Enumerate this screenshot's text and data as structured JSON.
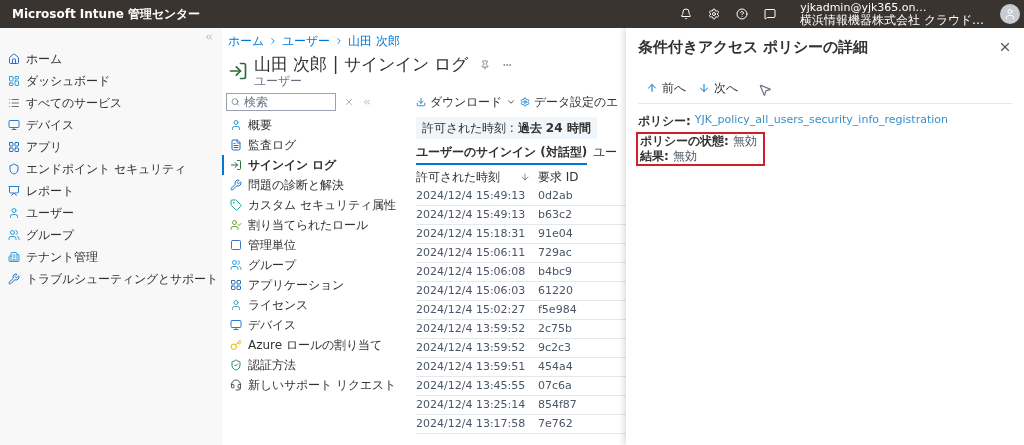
{
  "topbar": {
    "title": "Microsoft Intune 管理センター",
    "account": {
      "email": "yjkadmin@yjk365.on…",
      "org": "横浜情報機器株式会社 クラウド…"
    }
  },
  "left_nav": {
    "items": [
      {
        "label": "ホーム"
      },
      {
        "label": "ダッシュボード"
      },
      {
        "label": "すべてのサービス"
      },
      {
        "label": "デバイス"
      },
      {
        "label": "アプリ"
      },
      {
        "label": "エンドポイント セキュリティ"
      },
      {
        "label": "レポート"
      },
      {
        "label": "ユーザー"
      },
      {
        "label": "グループ"
      },
      {
        "label": "テナント管理"
      },
      {
        "label": "トラブルシューティングとサポート"
      }
    ]
  },
  "breadcrumb": [
    "ホーム",
    "ユーザー",
    "山田 次郎"
  ],
  "page": {
    "title": "山田 次郎 | サインイン ログ",
    "subtitle": "ユーザー"
  },
  "blade_menu": {
    "search": {
      "placeholder": "検索"
    },
    "items": [
      {
        "label": "概要",
        "selected": false
      },
      {
        "label": "監査ログ",
        "selected": false
      },
      {
        "label": "サインイン ログ",
        "selected": true
      },
      {
        "label": "問題の診断と解決",
        "selected": false
      },
      {
        "label": "カスタム セキュリティ属性",
        "selected": false
      },
      {
        "label": "割り当てられたロール",
        "selected": false
      },
      {
        "label": "管理単位",
        "selected": false
      },
      {
        "label": "グループ",
        "selected": false
      },
      {
        "label": "アプリケーション",
        "selected": false
      },
      {
        "label": "ライセンス",
        "selected": false
      },
      {
        "label": "デバイス",
        "selected": false
      },
      {
        "label": "Azure ロールの割り当て",
        "selected": false
      },
      {
        "label": "認証方法",
        "selected": false
      },
      {
        "label": "新しいサポート リクエスト",
        "selected": false
      }
    ]
  },
  "toolbar": {
    "download": "ダウンロード",
    "settings": "データ設定のエ"
  },
  "filter": {
    "label": "許可された時刻 :",
    "value": "過去 24 時間"
  },
  "tabs": [
    {
      "label": "ユーザーのサインイン (対話型)",
      "selected": true
    },
    {
      "label": "ユー",
      "selected": false
    }
  ],
  "table": {
    "columns": [
      "許可された時刻",
      "要求 ID"
    ],
    "rows": [
      [
        "2024/12/4 15:49:13",
        "0d2ab"
      ],
      [
        "2024/12/4 15:49:13",
        "b63c2"
      ],
      [
        "2024/12/4 15:18:31",
        "91e04"
      ],
      [
        "2024/12/4 15:06:11",
        "729ac"
      ],
      [
        "2024/12/4 15:06:08",
        "b4bc9"
      ],
      [
        "2024/12/4 15:06:03",
        "61220"
      ],
      [
        "2024/12/4 15:02:27",
        "f5e984"
      ],
      [
        "2024/12/4 13:59:52",
        "2c75b"
      ],
      [
        "2024/12/4 13:59:52",
        "9c2c3"
      ],
      [
        "2024/12/4 13:59:51",
        "454a4"
      ],
      [
        "2024/12/4 13:45:55",
        "07c6a"
      ],
      [
        "2024/12/4 13:25:14",
        "854f87"
      ],
      [
        "2024/12/4 13:17:58",
        "7e762"
      ]
    ]
  },
  "detail_panel": {
    "title": "条件付きアクセス ポリシーの詳細",
    "nav": {
      "previous": "前へ",
      "next": "次へ"
    },
    "policy": {
      "label": "ポリシー:",
      "value": "YJK_policy_all_users_security_info_registration"
    },
    "status": {
      "label": "ポリシーの状態:",
      "value": "無効"
    },
    "result": {
      "label": "結果:",
      "value": "無効"
    }
  }
}
